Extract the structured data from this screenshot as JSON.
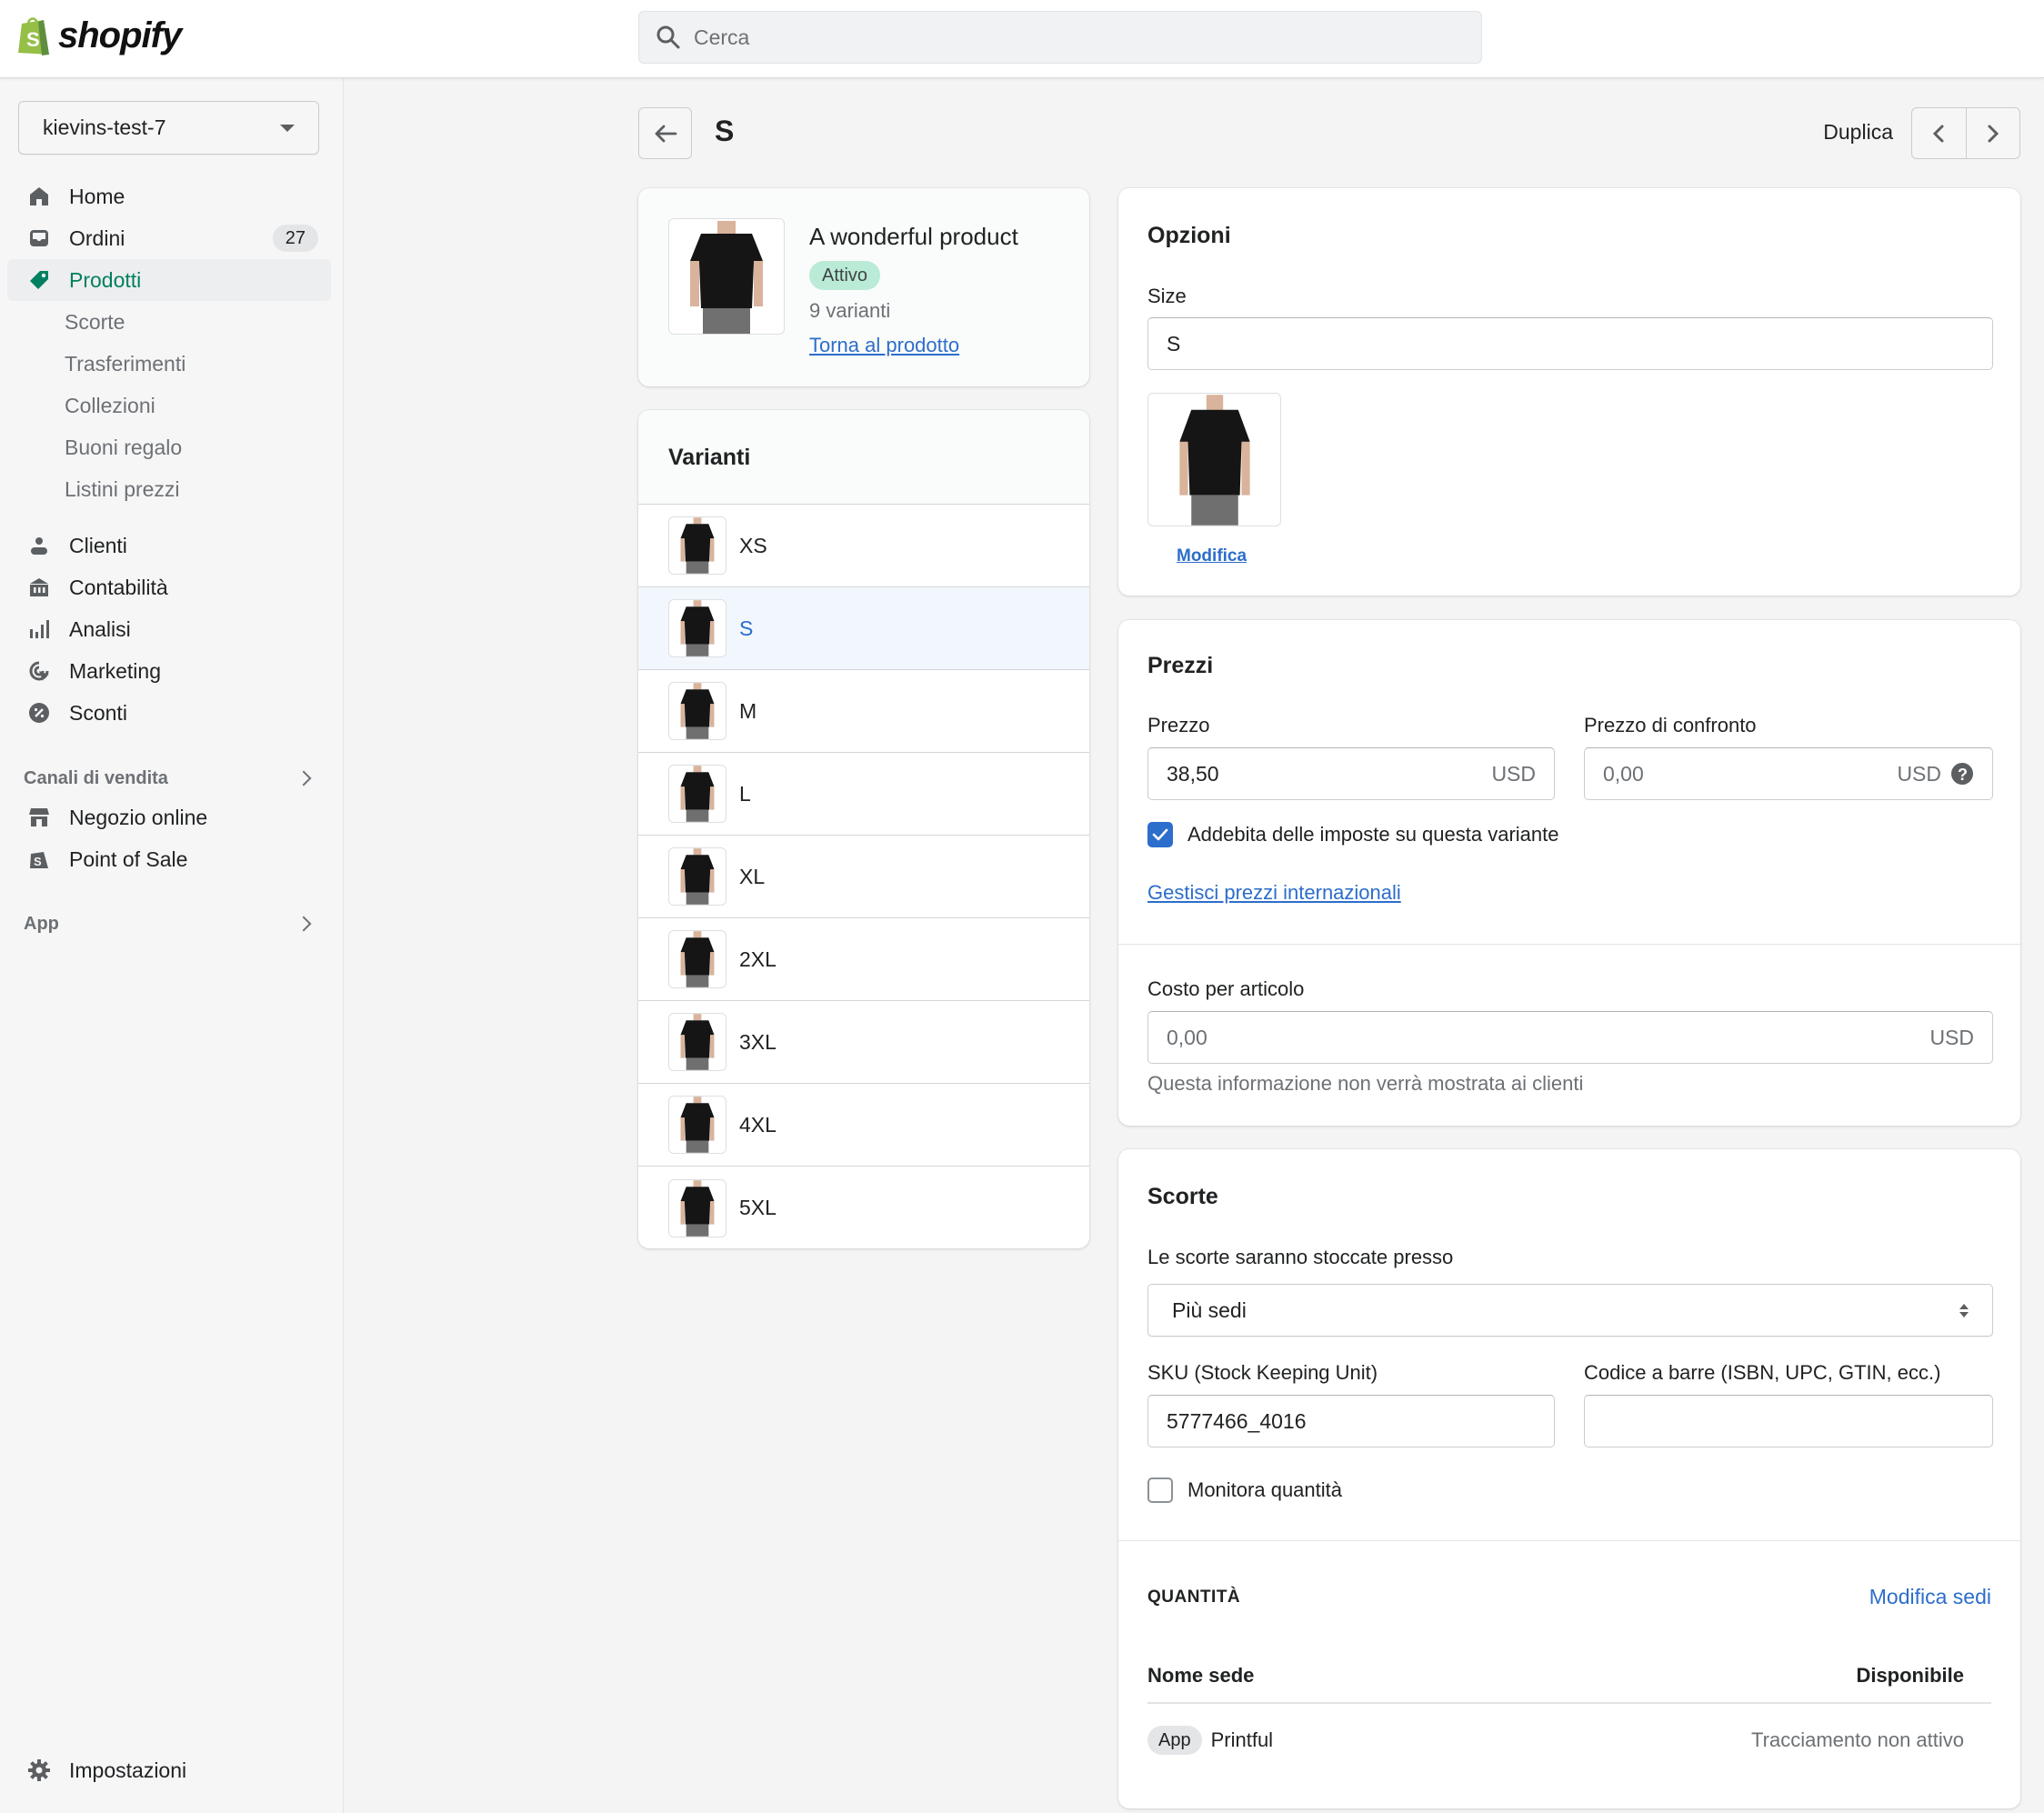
{
  "topbar": {
    "logo_text": "shopify",
    "search_placeholder": "Cerca"
  },
  "sidebar": {
    "store_name": "kievins-test-7",
    "items": [
      {
        "label": "Home",
        "icon": "home-icon"
      },
      {
        "label": "Ordini",
        "icon": "orders-icon",
        "badge": "27"
      },
      {
        "label": "Prodotti",
        "icon": "tag-icon",
        "active": true
      },
      {
        "label": "Scorte",
        "sub": true
      },
      {
        "label": "Trasferimenti",
        "sub": true
      },
      {
        "label": "Collezioni",
        "sub": true
      },
      {
        "label": "Buoni regalo",
        "sub": true
      },
      {
        "label": "Listini prezzi",
        "sub": true
      },
      {
        "label": "Clienti",
        "icon": "person-icon"
      },
      {
        "label": "Contabilità",
        "icon": "bank-icon"
      },
      {
        "label": "Analisi",
        "icon": "bar-chart-icon"
      },
      {
        "label": "Marketing",
        "icon": "target-icon"
      },
      {
        "label": "Sconti",
        "icon": "discount-icon"
      }
    ],
    "sales_channels_label": "Canali di vendita",
    "sales_channels": [
      {
        "label": "Negozio online",
        "icon": "store-icon"
      },
      {
        "label": "Point of Sale",
        "icon": "pos-bag-icon"
      }
    ],
    "apps_label": "App",
    "settings_label": "Impostazioni"
  },
  "header": {
    "title": "S",
    "duplicate_label": "Duplica"
  },
  "product": {
    "name": "A wonderful product",
    "status": "Attivo",
    "variant_count": "9 varianti",
    "back_link": "Torna al prodotto"
  },
  "variants": {
    "title": "Varianti",
    "items": [
      {
        "label": "XS"
      },
      {
        "label": "S",
        "selected": true
      },
      {
        "label": "M"
      },
      {
        "label": "L"
      },
      {
        "label": "XL"
      },
      {
        "label": "2XL"
      },
      {
        "label": "3XL"
      },
      {
        "label": "4XL"
      },
      {
        "label": "5XL"
      }
    ]
  },
  "options": {
    "title": "Opzioni",
    "size_label": "Size",
    "size_value": "S",
    "edit_image_link": "Modifica"
  },
  "pricing": {
    "title": "Prezzi",
    "price_label": "Prezzo",
    "price_value": "38,50",
    "currency": "USD",
    "compare_label": "Prezzo di confronto",
    "compare_placeholder": "0,00",
    "tax_checkbox_label": "Addebita delle imposte su questa variante",
    "tax_checked": true,
    "international_link": "Gestisci prezzi internazionali",
    "cost_label": "Costo per articolo",
    "cost_placeholder": "0,00",
    "cost_help": "Questa informazione non verrà mostrata ai clienti"
  },
  "inventory": {
    "title": "Scorte",
    "location_label": "Le scorte saranno stoccate presso",
    "location_value": "Più sedi",
    "sku_label": "SKU (Stock Keeping Unit)",
    "sku_value": "5777466_4016",
    "barcode_label": "Codice a barre (ISBN, UPC, GTIN, ecc.)",
    "barcode_value": "",
    "track_label": "Monitora quantità",
    "track_checked": false,
    "quantity_heading": "QUANTITÀ",
    "edit_locations_link": "Modifica sedi",
    "table_headers": [
      "Nome sede",
      "Disponibile"
    ],
    "rows": [
      {
        "badge": "App",
        "location": "Printful",
        "available": "Tracciamento non attivo"
      }
    ]
  },
  "colors": {
    "accent_green": "#008060",
    "link_blue": "#2c6ecb",
    "status_badge": "#aee9d1",
    "selected_row": "#f2f7fe"
  }
}
